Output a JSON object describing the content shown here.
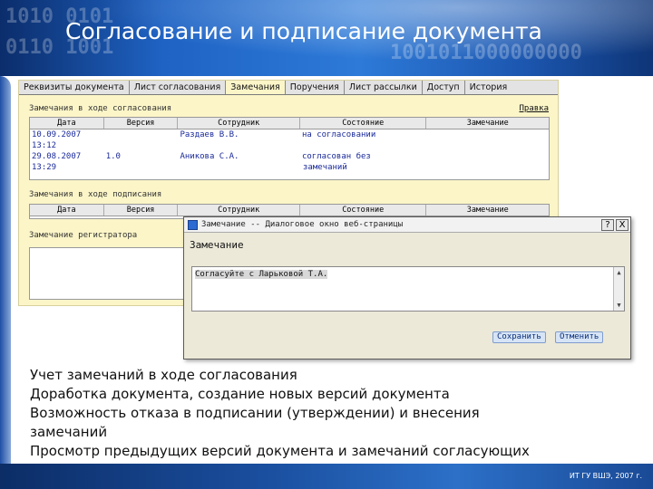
{
  "slide": {
    "title": "Согласование  и подписание документа",
    "bullets": [
      "Учет замечаний в ходе согласования",
      "Доработка документа, создание новых версий документа",
      "Возможность отказа в подписании (утверждении) и внесения",
      "замечаний",
      "Просмотр предыдущих версий документа и замечаний согласующих"
    ],
    "footer": "ИТ ГУ ВШЭ, 2007 г."
  },
  "app": {
    "tabs": [
      "Реквизиты документа",
      "Лист согласования",
      "Замечания",
      "Поручения",
      "Лист рассылки",
      "Доступ",
      "История"
    ],
    "active_tab": "Замечания",
    "edit_link": "Правка",
    "section_approval": "Замечания в ходе согласования",
    "section_signing": "Замечания в ходе подписания",
    "section_registrar": "Замечание регистратора",
    "columns": [
      "Дата",
      "Версия",
      "Сотрудник",
      "Состояние",
      "Замечание"
    ],
    "approval_rows": [
      {
        "date": "10.09.2007",
        "time": "13:12",
        "version": "",
        "employee": "Раздаев В.В.",
        "status": "на согласовании",
        "status2": "",
        "remark": ""
      },
      {
        "date": "29.08.2007",
        "time": "13:29",
        "version": "1.0",
        "employee": "Аникова С.А.",
        "status": "согласован без",
        "status2": "замечаний",
        "remark": ""
      }
    ]
  },
  "dialog": {
    "title": "Замечание -- Диалоговое окно веб-страницы",
    "label": "Замечание",
    "text": "Согласуйте с Ларьковой Т.А.",
    "save_label": "Сохранить",
    "cancel_label": "Отменить",
    "help_glyph": "?",
    "close_glyph": "X"
  },
  "colors": {
    "header": "#1f63c4",
    "panel": "#fbf5c8",
    "link": "#1a2a9a"
  }
}
